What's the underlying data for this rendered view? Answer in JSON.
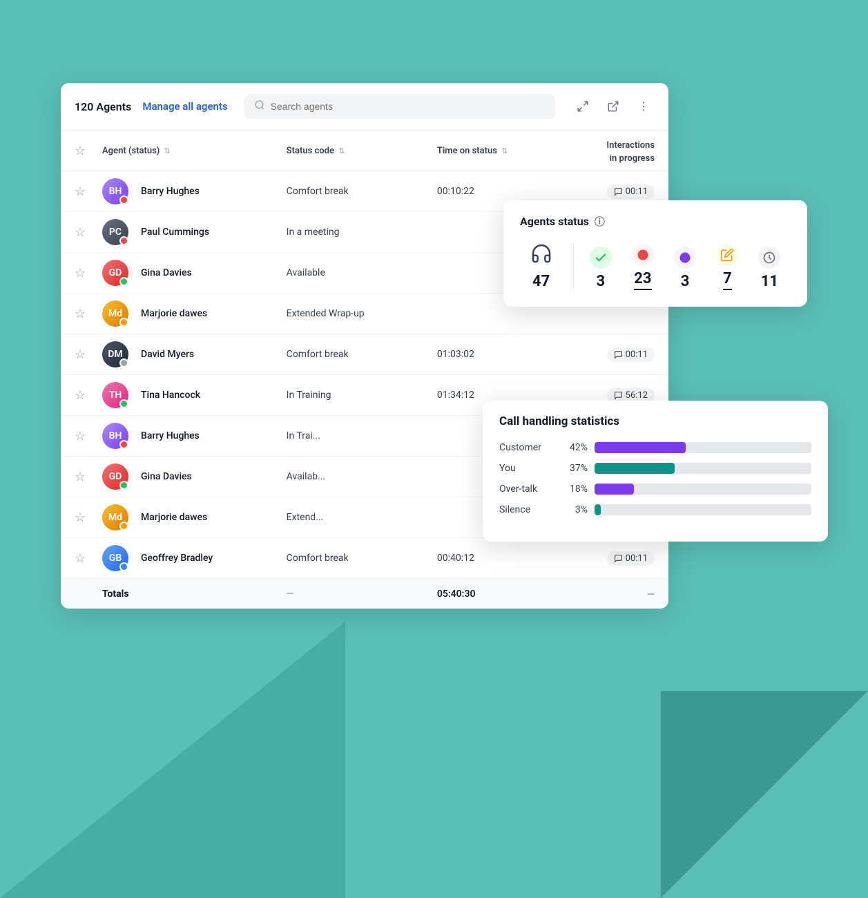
{
  "header": {
    "agent_count": "120 Agents",
    "manage_link": "Manage all agents",
    "search_placeholder": "Search agents"
  },
  "table": {
    "columns": {
      "agent": "Agent (status)",
      "status_code": "Status code",
      "time_on_status": "Time on status",
      "interactions": "Interactions\nin progress"
    },
    "rows": [
      {
        "name": "Barry Hughes",
        "avatar_color": "avatar-barry",
        "status_dot": "status-red",
        "status": "Comfort break",
        "time": "00:10:22",
        "interaction": "00:11",
        "has_interaction": true
      },
      {
        "name": "Paul Cummings",
        "avatar_color": "avatar-paul",
        "status_dot": "status-red",
        "status": "In a meeting",
        "time": "",
        "interaction": "",
        "has_interaction": false
      },
      {
        "name": "Gina Davies",
        "avatar_color": "avatar-gina",
        "status_dot": "status-green",
        "status": "Available",
        "time": "",
        "interaction": "",
        "has_interaction": false
      },
      {
        "name": "Marjorie dawes",
        "avatar_color": "avatar-marjorie",
        "status_dot": "status-yellow",
        "status": "Extended Wrap-up",
        "time": "",
        "interaction": "",
        "has_interaction": false
      },
      {
        "name": "David Myers",
        "avatar_color": "avatar-david",
        "status_dot": "status-gray",
        "status": "Comfort break",
        "time": "01:03:02",
        "interaction": "00:11",
        "has_interaction": true
      },
      {
        "name": "Tina Hancock",
        "avatar_color": "avatar-tina",
        "status_dot": "status-green",
        "status": "In Training",
        "time": "01:34:12",
        "interaction": "56:12",
        "has_interaction": true
      },
      {
        "name": "Barry Hughes",
        "avatar_color": "avatar-barry",
        "status_dot": "status-red",
        "status": "In Trai...",
        "time": "",
        "interaction": "",
        "has_interaction": false
      },
      {
        "name": "Gina Davies",
        "avatar_color": "avatar-gina",
        "status_dot": "status-green",
        "status": "Availab...",
        "time": "",
        "interaction": "",
        "has_interaction": false
      },
      {
        "name": "Marjorie dawes",
        "avatar_color": "avatar-marjorie",
        "status_dot": "status-yellow",
        "status": "Extend...",
        "time": "",
        "interaction": "",
        "has_interaction": false
      },
      {
        "name": "Geoffrey Bradley",
        "avatar_color": "avatar-geoffrey",
        "status_dot": "status-blue",
        "status": "Comfort break",
        "time": "00:40:12",
        "interaction": "00:11",
        "has_interaction": true
      }
    ],
    "totals": {
      "label": "Totals",
      "time": "05:40:30",
      "dash1": "—",
      "dash2": "—"
    }
  },
  "agents_status": {
    "title": "Agents status",
    "total": "47",
    "stats": [
      {
        "color": "#22c55e",
        "icon": "check",
        "count": "3",
        "underline": false
      },
      {
        "color": "#ef4444",
        "icon": "circle",
        "count": "23",
        "underline": true
      },
      {
        "color": "#7c3aed",
        "icon": "circle",
        "count": "3",
        "underline": false
      },
      {
        "color": "#f59e0b",
        "icon": "pen",
        "count": "7",
        "underline": true
      },
      {
        "color": "#6b7280",
        "icon": "clock",
        "count": "11",
        "underline": false
      }
    ]
  },
  "call_handling": {
    "title": "Call handling statistics",
    "bars": [
      {
        "label": "Customer",
        "pct": 42,
        "pct_label": "42%",
        "color": "#7c3aed"
      },
      {
        "label": "You",
        "pct": 37,
        "pct_label": "37%",
        "color": "#0d9488"
      },
      {
        "label": "Over-talk",
        "pct": 18,
        "pct_label": "18%",
        "color": "#7c3aed"
      },
      {
        "label": "Silence",
        "pct": 3,
        "pct_label": "3%",
        "color": "#0d9488"
      }
    ]
  }
}
